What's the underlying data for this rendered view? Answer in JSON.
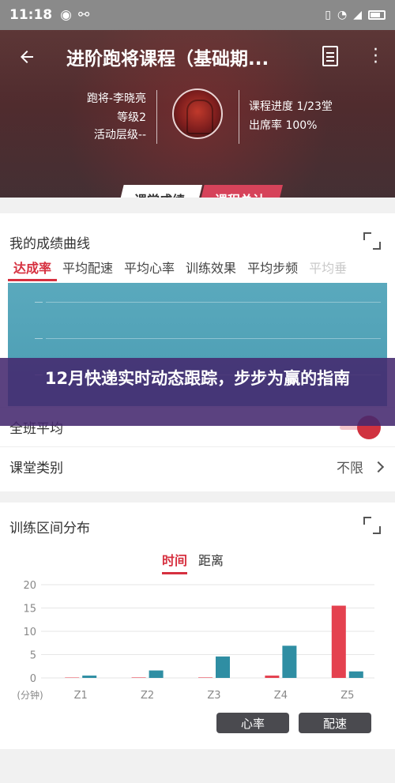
{
  "status": {
    "time": "11:18",
    "icons": [
      "weibo-icon",
      "usb-icon"
    ],
    "right_icons": [
      "vibrate-icon",
      "wifi-icon",
      "signal-icon",
      "battery-icon"
    ]
  },
  "header": {
    "title": "进阶跑将课程（基础期...",
    "coach_name": "跑将-李晓亮",
    "coach_level": "等级2",
    "coach_activity": "活动层级--",
    "course_progress": "课程进度 1/23堂",
    "attendance": "出席率 100%",
    "tabs": [
      "课堂成绩",
      "课程总计"
    ],
    "active_tab": 0
  },
  "grade_card": {
    "title": "我的成绩曲线",
    "metric_tabs": [
      "达成率",
      "平均配速",
      "平均心率",
      "训练效果",
      "平均步频",
      "平均垂"
    ],
    "active_metric": 0
  },
  "banner": {
    "text": "12月快递实时动态跟踪，步步为赢的指南"
  },
  "rows": {
    "class_average": "全班平均",
    "class_type_label": "课堂类别",
    "class_type_value": "不限"
  },
  "zone_card": {
    "title": "训练区间分布",
    "sub_tabs": [
      "时间",
      "距离"
    ],
    "active_sub_tab": 0,
    "legend": [
      "心率",
      "配速"
    ],
    "colors": {
      "heart_rate": "#e4414f",
      "pace": "#2f8ea3",
      "accent": "#d6303f"
    }
  },
  "chart_data": {
    "type": "bar",
    "categories": [
      "Z1",
      "Z2",
      "Z3",
      "Z4",
      "Z5"
    ],
    "series": [
      {
        "name": "心率",
        "values": [
          0,
          0.1,
          0.1,
          0.5,
          15.5
        ]
      },
      {
        "name": "配速",
        "values": [
          0.5,
          1.6,
          4.6,
          6.9,
          1.4
        ]
      }
    ],
    "ylabel": "(分钟)",
    "ylim": [
      0,
      20
    ],
    "yticks": [
      0,
      5,
      10,
      15,
      20
    ],
    "grid": true
  }
}
